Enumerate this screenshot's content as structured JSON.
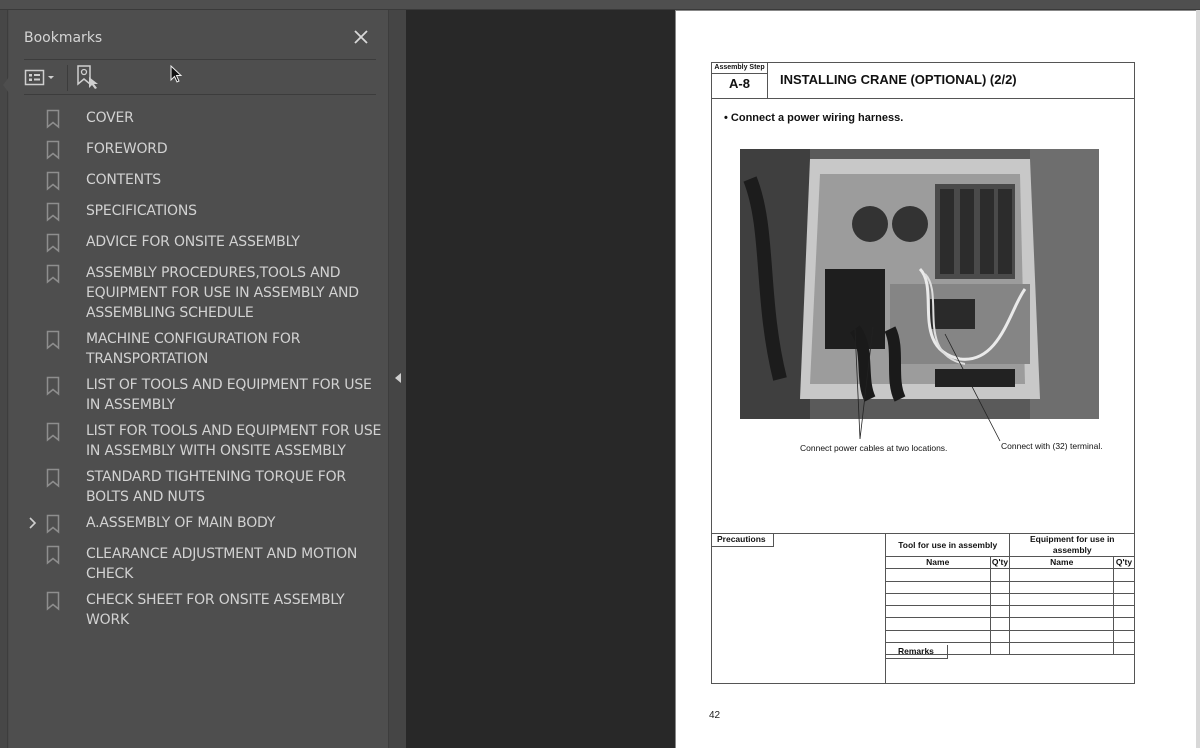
{
  "bookmarks_panel": {
    "title": "Bookmarks",
    "close_icon": "close-icon",
    "toolbar": {
      "options_icon": "list-options-icon",
      "find_icon": "find-current-bookmark-icon"
    },
    "items": [
      {
        "label": "COVER",
        "expandable": false
      },
      {
        "label": "FOREWORD",
        "expandable": false
      },
      {
        "label": "CONTENTS",
        "expandable": false
      },
      {
        "label": "SPECIFICATIONS",
        "expandable": false
      },
      {
        "label": "ADVICE FOR ONSITE ASSEMBLY",
        "expandable": false
      },
      {
        "label": "ASSEMBLY PROCEDURES,TOOLS AND EQUIPMENT FOR USE IN ASSEMBLY AND ASSEMBLING SCHEDULE",
        "expandable": false
      },
      {
        "label": "MACHINE CONFIGURATION FOR TRANSPORTATION",
        "expandable": false
      },
      {
        "label": "LIST OF TOOLS AND EQUIPMENT FOR USE IN ASSEMBLY",
        "expandable": false
      },
      {
        "label": "LIST FOR TOOLS AND EQUIPMENT FOR USE IN ASSEMBLY WITH ONSITE ASSEMBLY",
        "expandable": false
      },
      {
        "label": "STANDARD TIGHTENING TORQUE FOR BOLTS AND NUTS",
        "expandable": false
      },
      {
        "label": "A.ASSEMBLY OF MAIN BODY",
        "expandable": true
      },
      {
        "label": "CLEARANCE ADJUSTMENT AND MOTION CHECK",
        "expandable": false
      },
      {
        "label": "CHECK SHEET FOR ONSITE ASSEMBLY WORK",
        "expandable": false
      }
    ]
  },
  "document": {
    "step_label": "Assembly Step",
    "step_number": "A-8",
    "title": "INSTALLING CRANE (OPTIONAL) (2/2)",
    "instruction": "• Connect a power wiring harness.",
    "photo_alt": "Electrical control box with wiring harness",
    "callouts": [
      "Connect power cables at two locations.",
      "Connect with (32) terminal."
    ],
    "precautions_label": "Precautions",
    "tools_header": "Tool for use in assembly",
    "equipment_header": "Equipment for use in assembly",
    "col_name": "Name",
    "col_qty": "Q'ty",
    "empty_rows": 7,
    "remarks_label": "Remarks",
    "page_number": "42"
  },
  "colors": {
    "panel_bg": "#4e4e4e",
    "viewer_bg": "#282828",
    "text_light": "#d2d2d2",
    "page_bg": "#ffffff"
  }
}
